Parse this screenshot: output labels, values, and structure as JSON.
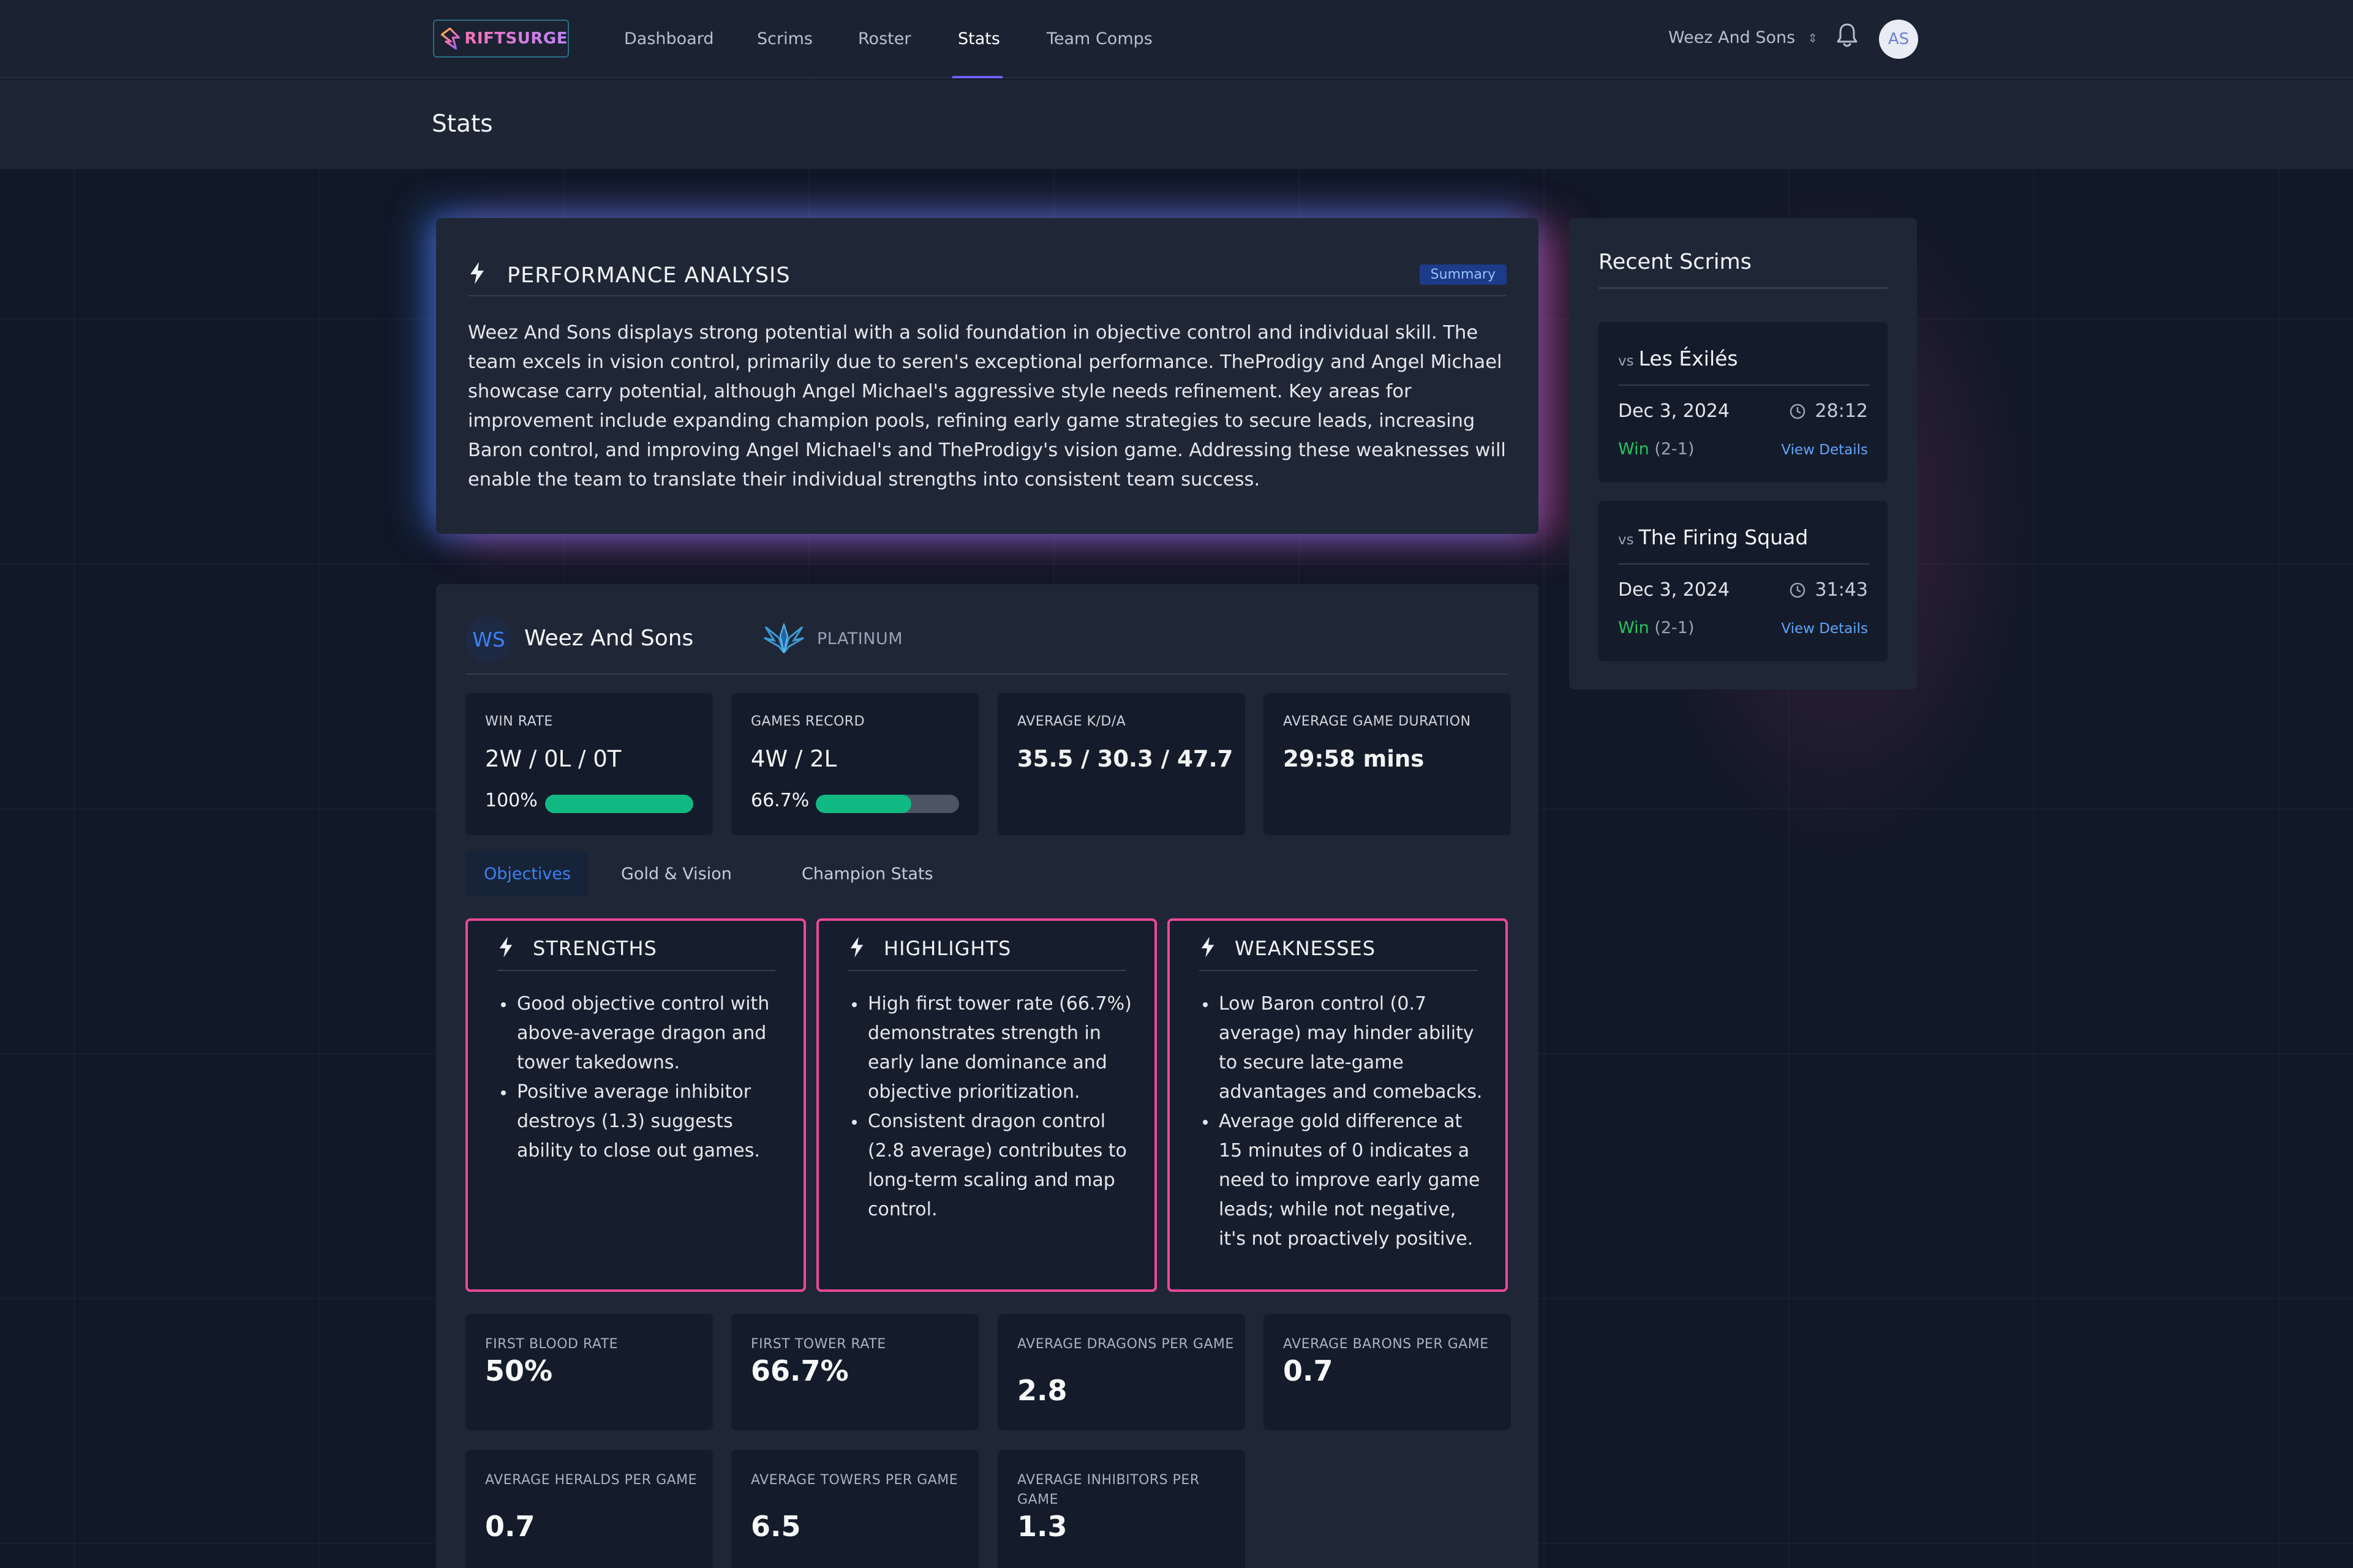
{
  "app": {
    "name": "RIFTSURGE"
  },
  "nav": {
    "links": [
      "Dashboard",
      "Scrims",
      "Roster",
      "Stats",
      "Team Comps"
    ],
    "active": "Stats",
    "team_selector": "Weez And Sons",
    "user_initials": "AS"
  },
  "page": {
    "title": "Stats"
  },
  "analysis": {
    "title": "PERFORMANCE ANALYSIS",
    "badge": "Summary",
    "text": "Weez And Sons displays strong potential with a solid foundation in objective control and individual skill. The team excels in vision control, primarily due to seren's exceptional performance. TheProdigy and Angel Michael showcase carry potential, although Angel Michael's aggressive style needs refinement. Key areas for improvement include expanding champion pools, refining early game strategies to secure leads, increasing Baron control, and improving Angel Michael's and TheProdigy's vision game. Addressing these weaknesses will enable the team to translate their individual strengths into consistent team success."
  },
  "team": {
    "initials": "WS",
    "name": "Weez And Sons",
    "rank": "PLATINUM"
  },
  "summary_stats": {
    "win_rate": {
      "label": "WIN RATE",
      "value": "2W / 0L / 0T",
      "percent_label": "100%",
      "percent": 100
    },
    "games_record": {
      "label": "GAMES RECORD",
      "value": "4W / 2L",
      "percent_label": "66.7%",
      "percent": 66.7
    },
    "kda": {
      "label": "AVERAGE K/D/A",
      "value": "35.5 / 30.3 / 47.7"
    },
    "duration": {
      "label": "AVERAGE GAME DURATION",
      "value": "29:58 mins"
    }
  },
  "tabs": [
    "Objectives",
    "Gold & Vision",
    "Champion Stats"
  ],
  "active_tab": "Objectives",
  "insights": {
    "strengths": {
      "title": "STRENGTHS",
      "items": [
        "Good objective control with above-average dragon and tower takedowns.",
        "Positive average inhibitor destroys (1.3) suggests ability to close out games."
      ]
    },
    "highlights": {
      "title": "HIGHLIGHTS",
      "items": [
        "High first tower rate (66.7%) demonstrates strength in early lane dominance and objective prioritization.",
        "Consistent dragon control (2.8 average) contributes to long-term scaling and map control."
      ]
    },
    "weaknesses": {
      "title": "WEAKNESSES",
      "items": [
        "Low Baron control (0.7 average) may hinder ability to secure late-game advantages and comebacks.",
        "Average gold difference at 15 minutes of 0 indicates a need to improve early game leads; while not negative, it's not proactively positive."
      ]
    }
  },
  "objective_stats": [
    {
      "label": "FIRST BLOOD RATE",
      "value": "50%"
    },
    {
      "label": "FIRST TOWER RATE",
      "value": "66.7%"
    },
    {
      "label": "AVERAGE DRAGONS PER GAME",
      "value": "2.8"
    },
    {
      "label": "AVERAGE BARONS PER GAME",
      "value": "0.7"
    },
    {
      "label": "AVERAGE HERALDS PER GAME",
      "value": "0.7"
    },
    {
      "label": "AVERAGE TOWERS PER GAME",
      "value": "6.5"
    },
    {
      "label": "AVERAGE INHIBITORS PER GAME",
      "value": "1.3"
    }
  ],
  "recent_scrims": {
    "title": "Recent Scrims",
    "vs_label": "vs",
    "items": [
      {
        "opponent": "Les Éxilés",
        "date": "Dec 3, 2024",
        "duration": "28:12",
        "result": "Win",
        "score": "(2-1)",
        "link": "View Details"
      },
      {
        "opponent": "The Firing Squad",
        "date": "Dec 3, 2024",
        "duration": "31:43",
        "result": "Win",
        "score": "(2-1)",
        "link": "View Details"
      }
    ]
  },
  "colors": {
    "accent": "#6d5ff0",
    "win": "#22c55e",
    "progress": "#10b981",
    "insight_border": "#ec4899",
    "link": "#60a5fa"
  }
}
